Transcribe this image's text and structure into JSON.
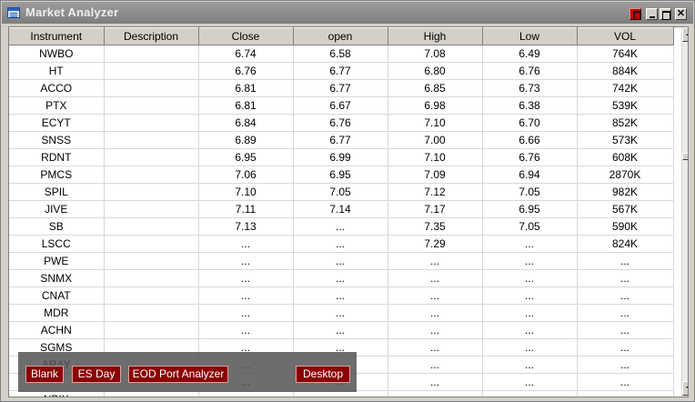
{
  "window": {
    "title": "Market Analyzer"
  },
  "table": {
    "columns": [
      "Instrument",
      "Description",
      "Close",
      "open",
      "High",
      "Low",
      "VOL"
    ],
    "rows": [
      [
        "NWBO",
        "",
        "6.74",
        "6.58",
        "7.08",
        "6.49",
        "764K"
      ],
      [
        "HT",
        "",
        "6.76",
        "6.77",
        "6.80",
        "6.76",
        "884K"
      ],
      [
        "ACCO",
        "",
        "6.81",
        "6.77",
        "6.85",
        "6.73",
        "742K"
      ],
      [
        "PTX",
        "",
        "6.81",
        "6.67",
        "6.98",
        "6.38",
        "539K"
      ],
      [
        "ECYT",
        "",
        "6.84",
        "6.76",
        "7.10",
        "6.70",
        "852K"
      ],
      [
        "SNSS",
        "",
        "6.89",
        "6.77",
        "7.00",
        "6.66",
        "573K"
      ],
      [
        "RDNT",
        "",
        "6.95",
        "6.99",
        "7.10",
        "6.76",
        "608K"
      ],
      [
        "PMCS",
        "",
        "7.06",
        "6.95",
        "7.09",
        "6.94",
        "2870K"
      ],
      [
        "SPIL",
        "",
        "7.10",
        "7.05",
        "7.12",
        "7.05",
        "982K"
      ],
      [
        "JIVE",
        "",
        "7.11",
        "7.14",
        "7.17",
        "6.95",
        "567K"
      ],
      [
        "SB",
        "",
        "7.13",
        "...",
        "7.35",
        "7.05",
        "590K"
      ],
      [
        "LSCC",
        "",
        "...",
        "...",
        "7.29",
        "...",
        "824K"
      ],
      [
        "PWE",
        "",
        "...",
        "...",
        "...",
        "...",
        "..."
      ],
      [
        "SNMX",
        "",
        "...",
        "...",
        "...",
        "...",
        "..."
      ],
      [
        "CNAT",
        "",
        "...",
        "...",
        "...",
        "...",
        "..."
      ],
      [
        "MDR",
        "",
        "...",
        "...",
        "...",
        "...",
        "..."
      ],
      [
        "ACHN",
        "",
        "...",
        "...",
        "...",
        "...",
        "..."
      ],
      [
        "SGMS",
        "",
        "...",
        "...",
        "...",
        "...",
        "..."
      ],
      [
        "ARAY",
        "",
        "...",
        "...",
        "...",
        "...",
        "..."
      ],
      [
        "",
        "",
        "...",
        "...",
        "...",
        "...",
        "..."
      ],
      [
        "NBIX",
        "",
        "...",
        "...",
        "...",
        "...",
        "..."
      ]
    ]
  },
  "toolbar": {
    "buttons": [
      {
        "label": "Blank"
      },
      {
        "label": "ES Day"
      },
      {
        "label": "EOD Port Analyzer"
      },
      {
        "label": "Desktop"
      }
    ]
  },
  "colors": {
    "toolbar_button_bg": "#8b0000",
    "titlebar": "#8a8a8a"
  }
}
